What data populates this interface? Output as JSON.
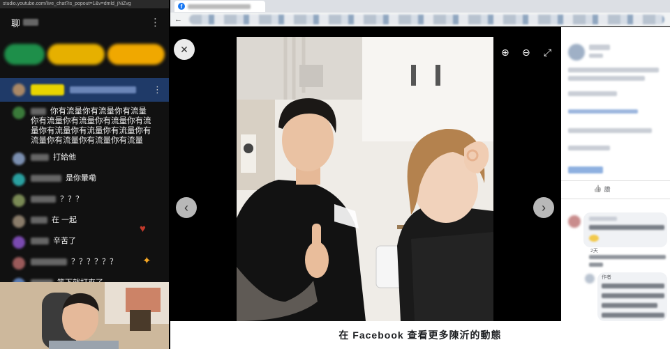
{
  "chat": {
    "url": "studio.youtube.com/live_chat?is_popout=1&v=dmld_jNiZvg",
    "title": "聊",
    "menu_icon": "⋮",
    "messages": [
      {
        "text": "你有流量你有流量你有流量你有流量你有流量你有流量你有流量你有流量你有流量你有流量你有流量你有流量你有流量你有流量"
      },
      {
        "text": "打給他"
      },
      {
        "text": "是你暈嘞"
      },
      {
        "text": "？？？"
      },
      {
        "text": "在 一起"
      },
      {
        "text": "辛苦了"
      },
      {
        "text": "？？？？？？"
      },
      {
        "text": "等下就打來了"
      }
    ]
  },
  "browser": {
    "tab_icon": "f",
    "back_icon": "←"
  },
  "viewer": {
    "close_icon": "✕",
    "zoom_in_icon": "⊕",
    "zoom_out_icon": "⊖",
    "fullscreen_icon": "⤢",
    "prev_icon": "‹",
    "next_icon": "›"
  },
  "sidebar": {
    "like_icon": "👍",
    "like_label": "讚",
    "comment_time": "2天",
    "author_badge": "作者"
  },
  "bottom": {
    "text": "在 Facebook 查看更多陳沂的動態"
  }
}
